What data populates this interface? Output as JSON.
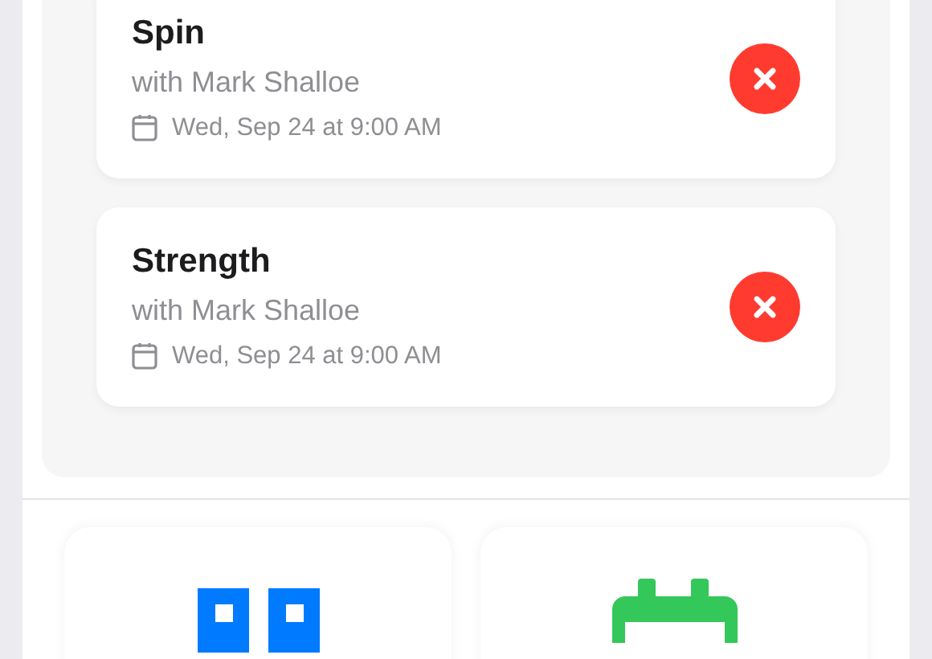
{
  "bookings": [
    {
      "title": "Spin",
      "instructor": "with Mark Shalloe",
      "date": "Wed, Sep 24 at 9:00 AM"
    },
    {
      "title": "Strength",
      "instructor": "with Mark Shalloe",
      "date": "Wed, Sep 24 at 9:00 AM"
    }
  ],
  "tiles": [
    {
      "kind": "grid"
    },
    {
      "kind": "calendar"
    }
  ]
}
